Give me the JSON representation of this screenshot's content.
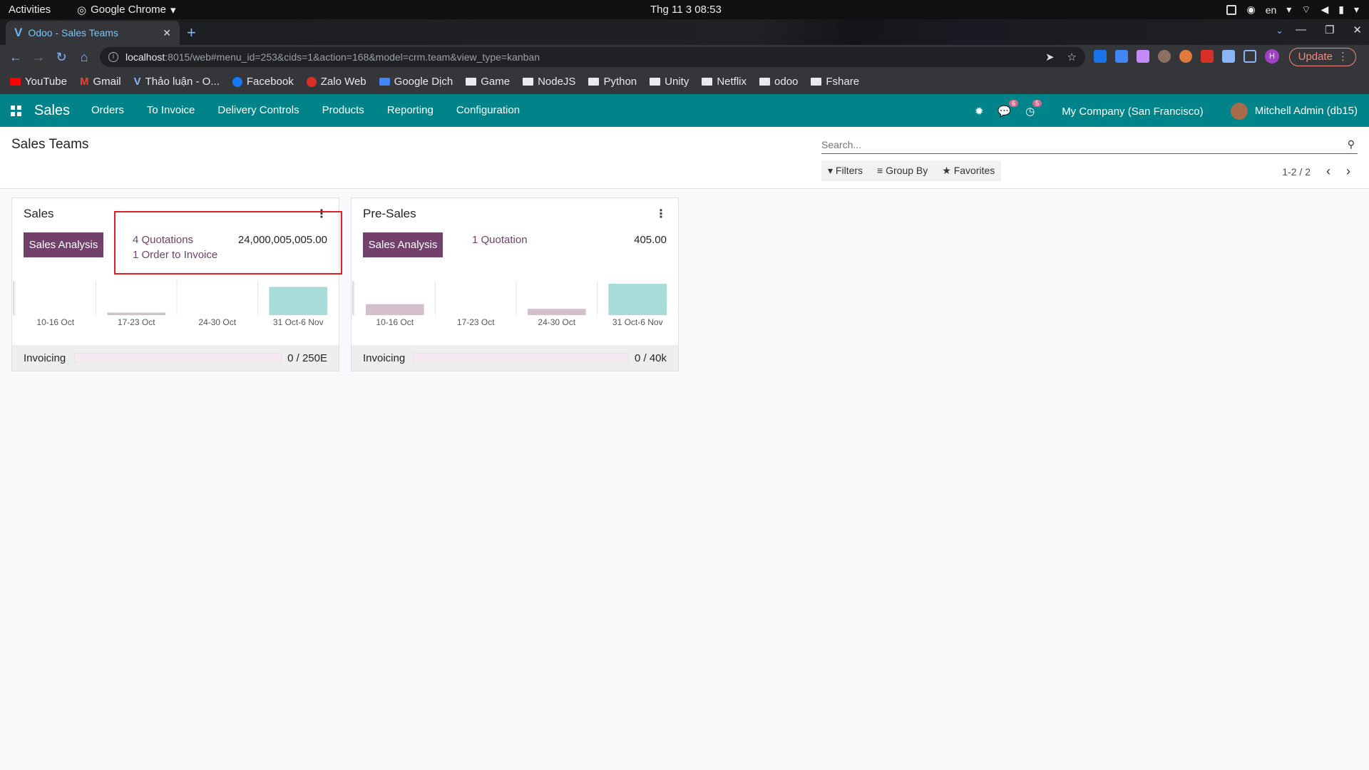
{
  "os": {
    "activities": "Activities",
    "app_name": "Google Chrome",
    "clock": "Thg 11 3  08:53",
    "lang": "en"
  },
  "browser": {
    "tab_title": "Odoo - Sales Teams",
    "url_host": "localhost",
    "url_rest": ":8015/web#menu_id=253&cids=1&action=168&model=crm.team&view_type=kanban",
    "update_label": "Update",
    "profile_initial": "H",
    "bookmarks": [
      "YouTube",
      "Gmail",
      "Thảo luận - O...",
      "Facebook",
      "Zalo Web",
      "Google Dịch",
      "Game",
      "NodeJS",
      "Python",
      "Unity",
      "Netflix",
      "odoo",
      "Fshare"
    ]
  },
  "odoo": {
    "app": "Sales",
    "menu": [
      "Orders",
      "To Invoice",
      "Delivery Controls",
      "Products",
      "Reporting",
      "Configuration"
    ],
    "chat_badge": "6",
    "activity_badge": "5",
    "company": "My Company (San Francisco)",
    "user": "Mitchell Admin (db15)"
  },
  "control_panel": {
    "title": "Sales Teams",
    "search_placeholder": "Search...",
    "filters": "Filters",
    "group_by": "Group By",
    "favorites": "Favorites",
    "pager": "1-2 / 2"
  },
  "teams": [
    {
      "name": "Sales",
      "button": "Sales Analysis",
      "link1": "4 Quotations",
      "link2": "1 Order to Invoice",
      "amount": "24,000,005,005.00",
      "chart_labels": [
        "10-16 Oct",
        "17-23 Oct",
        "24-30 Oct",
        "31 Oct-6 Nov"
      ],
      "bars": [
        0,
        0.08,
        0,
        0.9
      ],
      "footer_label": "Invoicing",
      "footer_value": "0 / 250E",
      "progress": 0
    },
    {
      "name": "Pre-Sales",
      "button": "Sales Analysis",
      "link1": "1 Quotation",
      "link2": "",
      "amount": "405.00",
      "chart_labels": [
        "10-16 Oct",
        "17-23 Oct",
        "24-30 Oct",
        "31 Oct-6 Nov"
      ],
      "bars": [
        0.35,
        0,
        0.2,
        1.0
      ],
      "footer_label": "Invoicing",
      "footer_value": "0 / 40k",
      "progress": 0
    }
  ],
  "colors": {
    "odoo_teal": "#00848a",
    "odoo_purple": "#71416b",
    "bar_past": "#d4bfcd",
    "bar_current": "#a9dcd9",
    "highlight": "#e02020"
  }
}
